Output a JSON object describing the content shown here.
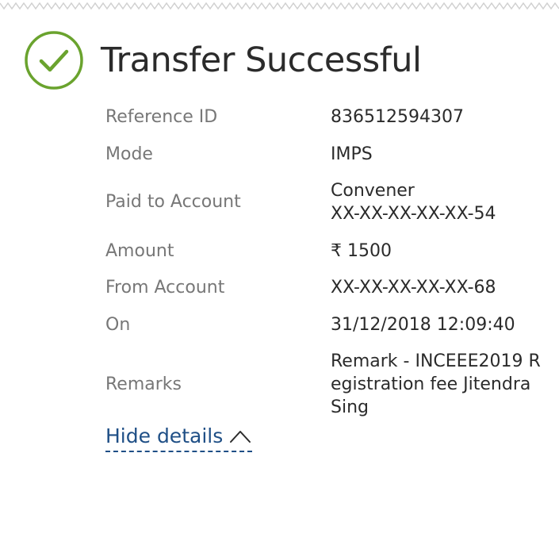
{
  "header": {
    "title": "Transfer Successful",
    "status_icon": "check-circle-icon",
    "status_color": "#6aa32e"
  },
  "details": [
    {
      "key": "reference_id",
      "label": "Reference ID",
      "value_lines": [
        "836512594307"
      ]
    },
    {
      "key": "mode",
      "label": "Mode",
      "value_lines": [
        "IMPS"
      ]
    },
    {
      "key": "paid_to_account",
      "label": "Paid to Account",
      "value_lines": [
        "Convener",
        "XX-XX-XX-XX-XX-54"
      ]
    },
    {
      "key": "amount",
      "label": "Amount",
      "value_lines": [
        "₹ 1500"
      ]
    },
    {
      "key": "from_account",
      "label": "From Account",
      "value_lines": [
        "XX-XX-XX-XX-XX-68"
      ]
    },
    {
      "key": "on",
      "label": "On",
      "value_lines": [
        "31/12/2018 12:09:40"
      ]
    },
    {
      "key": "remarks",
      "label": "Remarks",
      "value_lines": [
        "Remark - INCEEE2019 R",
        "egistration fee Jitendra",
        "Sing"
      ]
    }
  ],
  "toggle": {
    "label": "Hide details",
    "icon": "chevron-up-icon",
    "color": "#1f4f86"
  }
}
